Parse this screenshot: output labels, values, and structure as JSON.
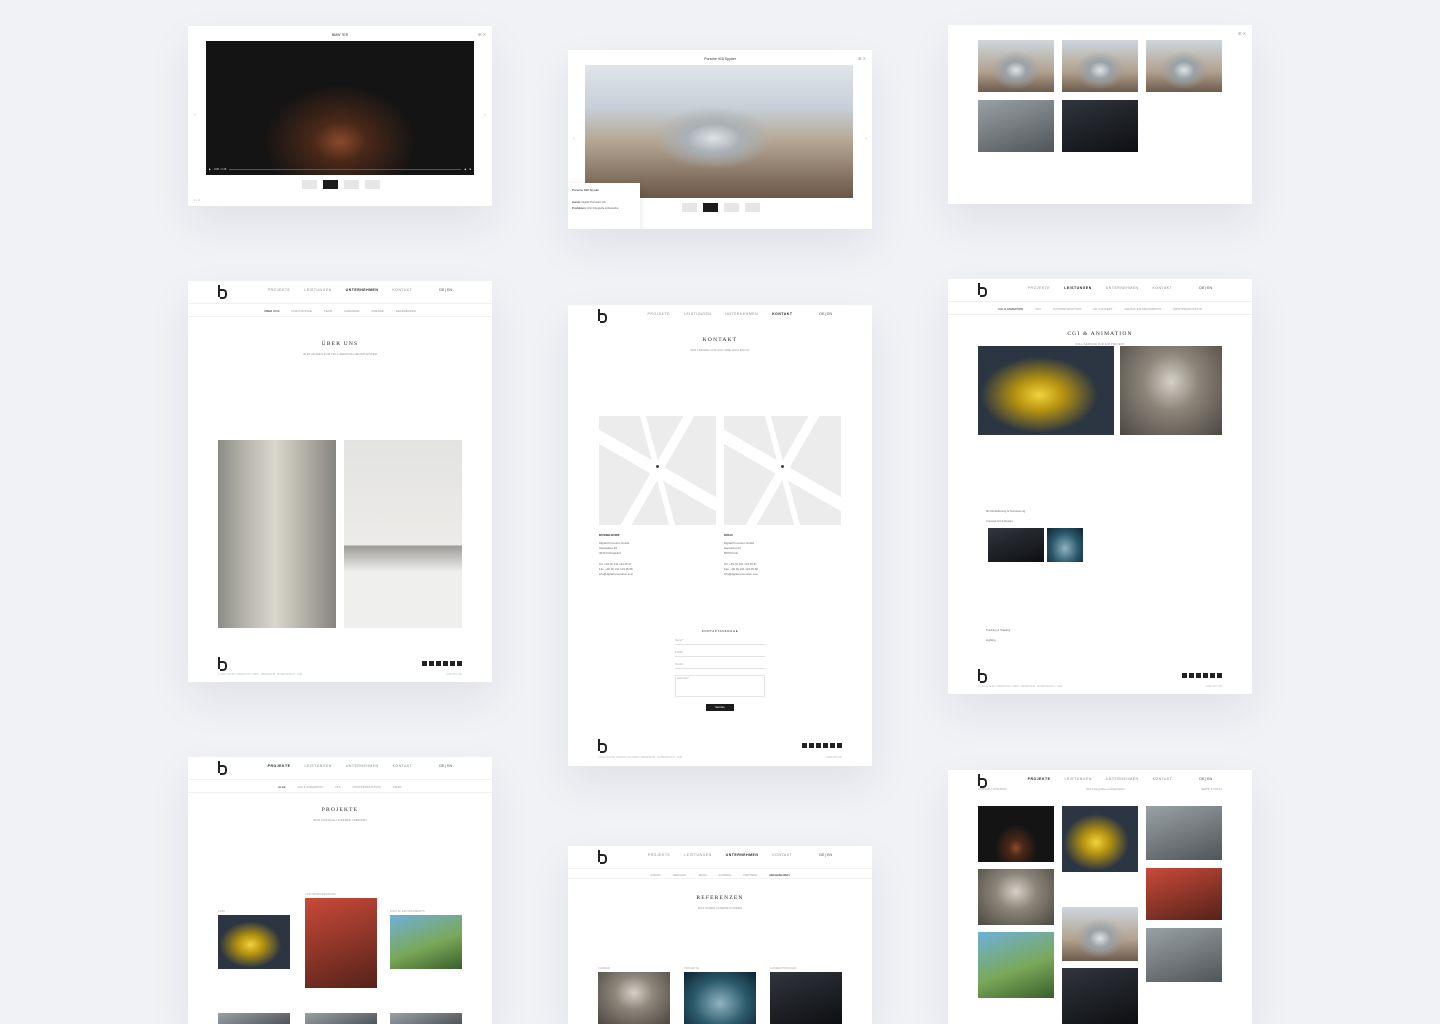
{
  "nav": {
    "items": [
      "PROJEKTE",
      "LEISTUNGEN",
      "UNTERNEHMEN",
      "KONTAKT"
    ],
    "lang": "DE | EN"
  },
  "card1": {
    "modal_title": "BMW 7ER",
    "time": "0:00 / 1:48",
    "page": "1 / 4"
  },
  "card2": {
    "modal_title": "Porsche 918 Spyder",
    "info_title": "Porsche 918 Spyder",
    "info_row1_label": "Kunde:",
    "info_row1_value": "Digital Promotion AG",
    "info_row2_label": "Produktion:",
    "info_row2_value": "CGI Fotografie & Retusche"
  },
  "card4": {
    "subnav": [
      "ÜBER UNS",
      "PHILOSOPHIE",
      "TEAM",
      "KARRIERE",
      "PRESSE",
      "REFERENZEN"
    ],
    "title": "ÜBER UNS",
    "subtitle": "IN 20 JAHREN ZUM FULL-SERVICE-DIENSTLEISTER"
  },
  "card5": {
    "title": "KONTAKT",
    "subtitle": "WIR FREUEN UNS AUF IHRE NACHRICHT",
    "office1": {
      "city": "DÜSSELDORF",
      "line1": "Digital Promotion GmbH",
      "line2": "Hansaallee 48",
      "line3": "40474 Düsseldorf",
      "tel": "Tel. +49 (0) 211 123 45 67",
      "fax": "Fax. +49 (0) 211 123 45 68",
      "mail": "info@digital-promotion.com"
    },
    "office2": {
      "city": "KÖLN",
      "line1": "Digital Promotion GmbH",
      "line2": "Hansaring 22",
      "line3": "50670 Köln",
      "tel": "Tel. +49 (0) 221 123 45 67",
      "fax": "Fax. +49 (0) 221 123 45 68",
      "mail": "info@digital-promotion.com"
    },
    "form_title": "KONTAKTANFRAGE",
    "field_name": "Name*",
    "field_email": "E-Mail*",
    "field_phone": "Telefon",
    "field_message": "Nachricht*",
    "submit": "Senden"
  },
  "card6": {
    "subnav": [
      "CGI & ANIMATION",
      "VFX",
      "POSTPRODUKTION",
      "3D CONCEPT",
      "DIGITAL ENVIRONMENTS",
      "PRINTPRODUKTION"
    ],
    "title": "CGI & ANIMATION",
    "subtitle": "FULL-SERVICE FÜR IHR PROJEKT",
    "bullets": [
      "3D Modellierung & Texturierung",
      "Concept Art & Design",
      "Tracking & Shading",
      "Lighting"
    ]
  },
  "card7": {
    "subnav": [
      "ALLE",
      "CGI & ANIMATION",
      "VFX",
      "POSTPRODUKTION",
      "PRINT"
    ],
    "title": "PROJEKTE",
    "subtitle": "EINE AUSWAHL UNSERER ARBEITEN",
    "tags": [
      "AUDI",
      "AUTOMOBILWERBUNG",
      "DIGITAL ENVIRONMENTS"
    ]
  },
  "card8": {
    "subnav": [
      "VISION",
      "VERLAUF",
      "TEAM",
      "KUNDEN",
      "PARTNER",
      "REFERENZEN"
    ],
    "title": "REFERENZEN",
    "subtitle": "DAS SAGEN UNSERE KUNDEN",
    "labels": [
      "KUNDEN",
      "PROJEKTE",
      "AUSZEICHNUNGEN"
    ]
  },
  "card9": {
    "crumb_left": "ZURÜCK | KONTAKT",
    "crumb_center": "CGI Fotografie und Retusche",
    "crumb_right": "SEITE 1 VON 2"
  },
  "footer": {
    "legal_left": "© 2018 DIGITAL PROMOTION GMBH · IMPRESSUM · DATENSCHUTZ · AGB",
    "legal_right": "ENGLISH | DE"
  }
}
